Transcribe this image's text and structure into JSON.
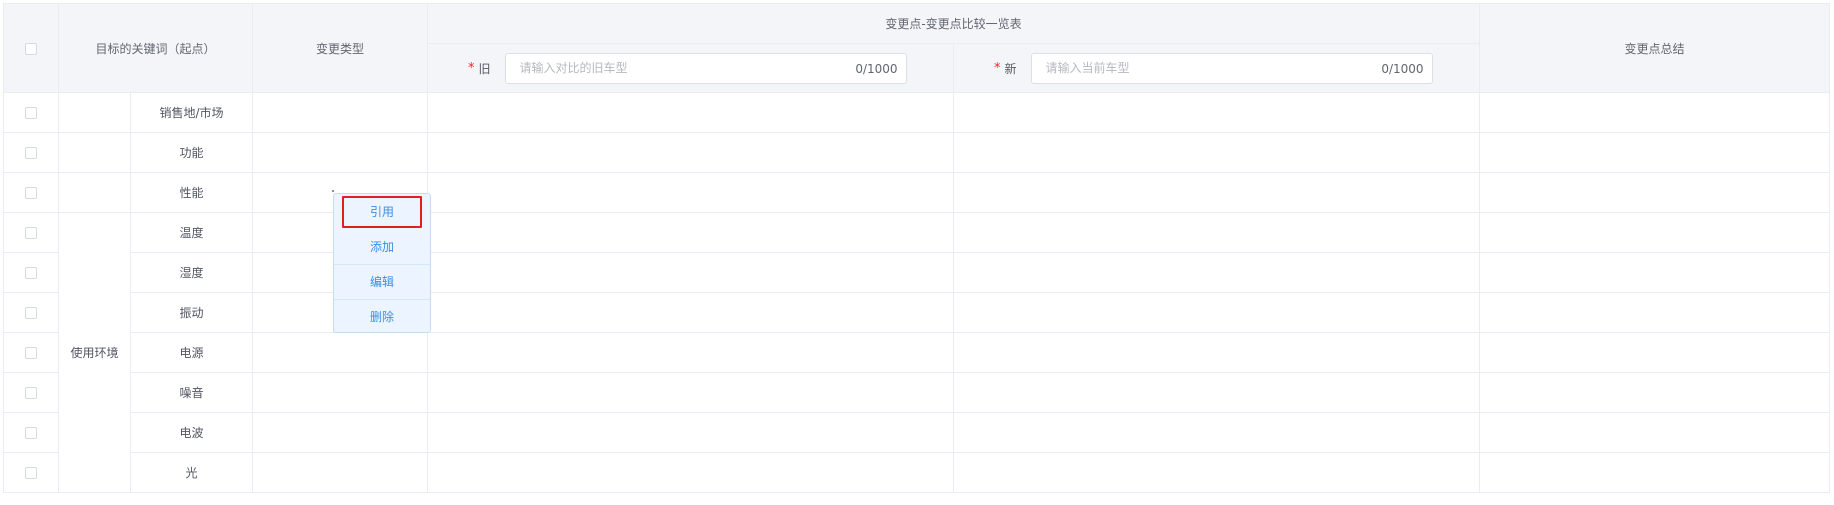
{
  "table": {
    "headers": {
      "keyword": "目标的关键词（起点）",
      "change_type": "变更类型",
      "comparison": "变更点-变更点比较一览表",
      "summary": "变更点总结"
    },
    "old_field": {
      "label": "旧",
      "placeholder": "请输入对比的旧车型",
      "count": "0/1000"
    },
    "new_field": {
      "label": "新",
      "placeholder": "请输入当前车型",
      "count": "0/1000"
    },
    "group_label": "使用环境",
    "rows": [
      {
        "name": "销售地/市场"
      },
      {
        "name": "功能"
      },
      {
        "name": "性能"
      },
      {
        "name": "温度"
      },
      {
        "name": "湿度"
      },
      {
        "name": "振动"
      },
      {
        "name": "电源"
      },
      {
        "name": "噪音"
      },
      {
        "name": "电波"
      },
      {
        "name": "光"
      }
    ]
  },
  "context_menu": {
    "items": [
      {
        "label": "引用",
        "highlighted": true
      },
      {
        "label": "添加"
      },
      {
        "label": "编辑"
      },
      {
        "label": "删除"
      }
    ]
  },
  "colors": {
    "header_bg": "#f4f5f8",
    "border": "#e9ecf1",
    "required": "#f5222d",
    "menu_text": "#3a8ee6",
    "menu_bg": "#ecf5ff",
    "highlight_border": "#e02020"
  }
}
